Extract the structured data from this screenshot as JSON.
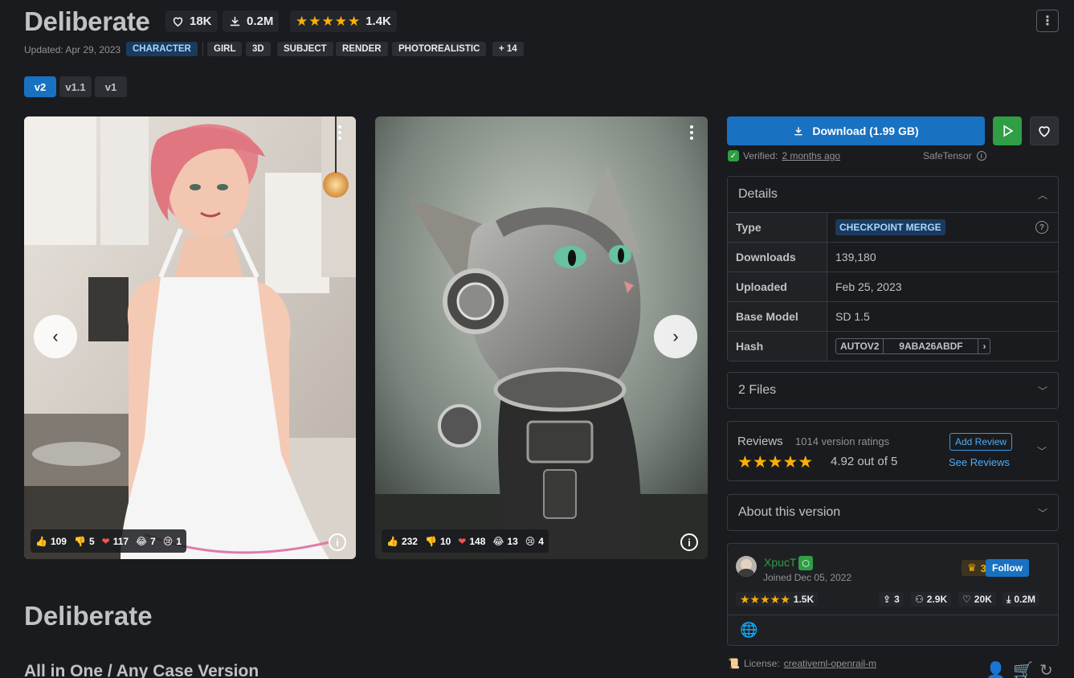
{
  "model": {
    "title": "Deliberate",
    "likes": "18K",
    "downloads": "0.2M",
    "rating_count": "1.4K",
    "updated": "Updated: Apr 29, 2023",
    "tags": [
      "CHARACTER",
      "GIRL",
      "3D",
      "SUBJECT",
      "RENDER",
      "PHOTOREALISTIC"
    ],
    "more_tags": "+ 14"
  },
  "versions": [
    "v2",
    "v1.1",
    "v1"
  ],
  "images": [
    {
      "reactions": {
        "like": "109",
        "dislike": "5",
        "heart": "117",
        "laugh": "7",
        "cry": "1"
      }
    },
    {
      "reactions": {
        "like": "232",
        "dislike": "10",
        "heart": "148",
        "laugh": "13",
        "cry": "4"
      }
    }
  ],
  "download": {
    "label": "Download (1.99 GB)"
  },
  "verified": {
    "prefix": "Verified:",
    "when": "2 months ago",
    "format": "SafeTensor"
  },
  "details": {
    "title": "Details",
    "rows": {
      "type_label": "Type",
      "type_value": "CHECKPOINT MERGE",
      "downloads_label": "Downloads",
      "downloads_value": "139,180",
      "uploaded_label": "Uploaded",
      "uploaded_value": "Feb 25, 2023",
      "base_label": "Base Model",
      "base_value": "SD 1.5",
      "hash_label": "Hash",
      "hash_type": "AUTOV2",
      "hash_value": "9ABA26ABDF"
    }
  },
  "files": {
    "title": "2 Files"
  },
  "reviews": {
    "title": "Reviews",
    "count": "1014 version ratings",
    "score": "4.92 out of 5",
    "add": "Add Review",
    "see": "See Reviews"
  },
  "about": {
    "title": "About this version"
  },
  "creator": {
    "name": "XpucT",
    "joined": "Joined Dec 05, 2022",
    "rank": "31",
    "follow": "Follow",
    "ratings": "1.5K",
    "uploads": "3",
    "followers": "2.9K",
    "likes": "20K",
    "downloads": "0.2M"
  },
  "description": {
    "title": "Deliberate",
    "subtitle": "All in One / Any Case Version"
  },
  "license": {
    "label": "License:",
    "name": "creativeml-openrail-m"
  },
  "colors": {
    "accent": "#1971c2",
    "success": "#2f9e44",
    "star": "#fab005",
    "bg": "#1a1b1e"
  }
}
